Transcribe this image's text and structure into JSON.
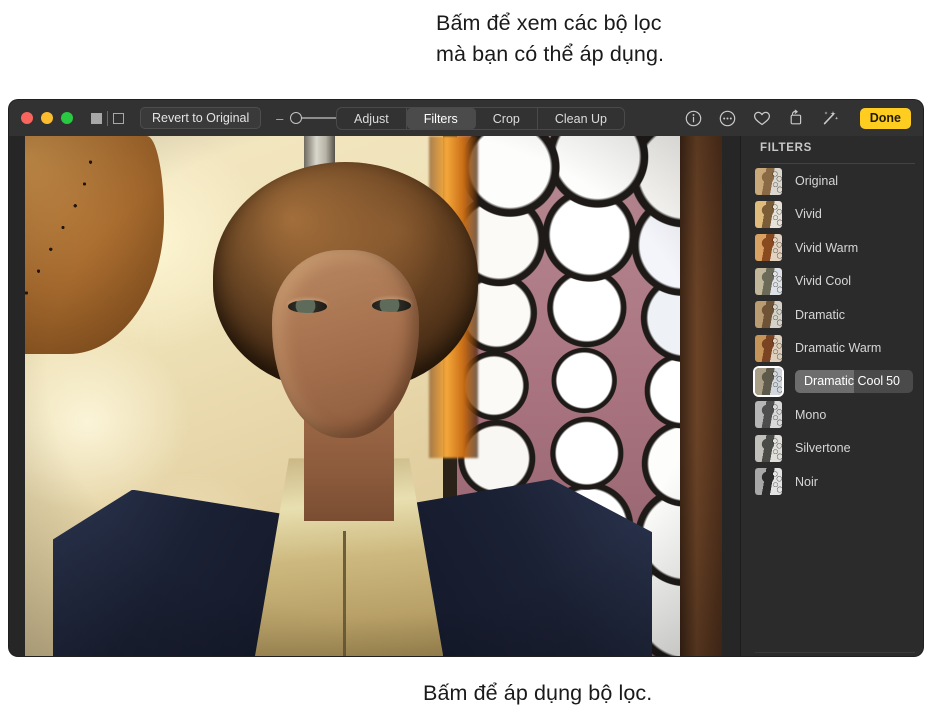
{
  "annotations": {
    "top": "Bấm để xem các bộ lọc\nmà bạn có thể áp dụng.",
    "bottom": "Bấm để áp dụng bộ lọc."
  },
  "window": {
    "toolbar": {
      "traffic_lights": [
        "close",
        "minimize",
        "zoom"
      ],
      "compare_toggle_name": "compare-toggle",
      "revert_label": "Revert to Original",
      "zoom_slider": {
        "minus": "–",
        "plus": "+",
        "value": 0
      },
      "segments": [
        {
          "label": "Adjust",
          "active": false
        },
        {
          "label": "Filters",
          "active": true
        },
        {
          "label": "Crop",
          "active": false
        },
        {
          "label": "Clean Up",
          "active": false
        }
      ],
      "icons": [
        {
          "name": "info-icon",
          "glyph": "info"
        },
        {
          "name": "more-options-icon",
          "glyph": "ellipsis"
        },
        {
          "name": "favorite-heart-icon",
          "glyph": "heart"
        },
        {
          "name": "rotate-icon",
          "glyph": "rotate"
        },
        {
          "name": "auto-enhance-wand-icon",
          "glyph": "wand"
        }
      ],
      "done_label": "Done",
      "done_color": "#ffcd20"
    },
    "sidebar": {
      "title": "FILTERS",
      "filters": [
        {
          "label": "Original",
          "selected": false,
          "value": ""
        },
        {
          "label": "Vivid",
          "selected": false,
          "value": ""
        },
        {
          "label": "Vivid Warm",
          "selected": false,
          "value": ""
        },
        {
          "label": "Vivid Cool",
          "selected": false,
          "value": ""
        },
        {
          "label": "Dramatic",
          "selected": false,
          "value": ""
        },
        {
          "label": "Dramatic Warm",
          "selected": false,
          "value": ""
        },
        {
          "label": "Dramatic Cool",
          "selected": true,
          "value": "50"
        },
        {
          "label": "Mono",
          "selected": false,
          "value": ""
        },
        {
          "label": "Silvertone",
          "selected": false,
          "value": ""
        },
        {
          "label": "Noir",
          "selected": false,
          "value": ""
        }
      ]
    },
    "photo": {
      "name": "edited-photo",
      "description": "Portrait of a person with curly hair in a navy jacket over a gold satin hoodie, in front of a sunlit wall and a wall of white plates"
    }
  }
}
